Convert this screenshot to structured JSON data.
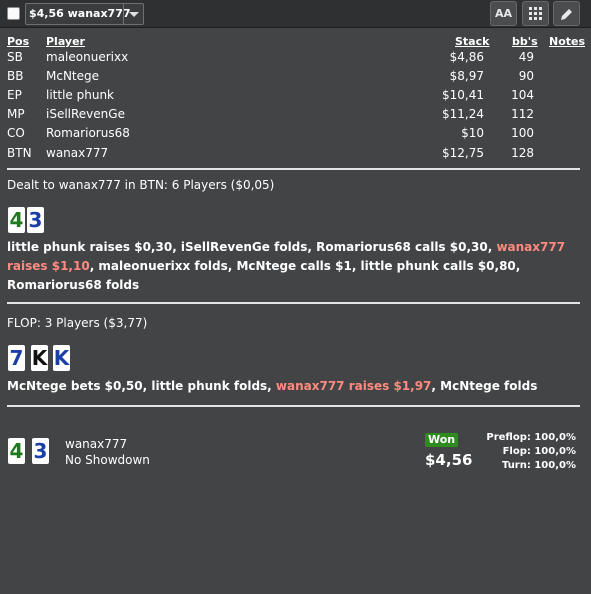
{
  "toolbar": {
    "dropdown_value": "$4,56 wanax777",
    "font_button_label": "AA"
  },
  "table": {
    "headers": {
      "pos": "Pos",
      "player": "Player",
      "stack": "Stack",
      "bbs": "bb's",
      "notes": "Notes"
    },
    "rows": [
      {
        "pos": "SB",
        "player": "maleonuerixx",
        "stack": "$4,86",
        "bbs": "49"
      },
      {
        "pos": "BB",
        "player": "McNtege",
        "stack": "$8,97",
        "bbs": "90"
      },
      {
        "pos": "EP",
        "player": "little phunk",
        "stack": "$10,41",
        "bbs": "104"
      },
      {
        "pos": "MP",
        "player": "iSellRevenGe",
        "stack": "$11,24",
        "bbs": "112"
      },
      {
        "pos": "CO",
        "player": "Romariorus68",
        "stack": "$10",
        "bbs": "100"
      },
      {
        "pos": "BTN",
        "player": "wanax777",
        "stack": "$12,75",
        "bbs": "128"
      }
    ]
  },
  "preflop": {
    "header": "Dealt to wanax777 in BTN: 6 Players ($0,05)",
    "hero_cards": [
      {
        "rank": "4",
        "suit_color": "green"
      },
      {
        "rank": "3",
        "suit_color": "blue"
      }
    ],
    "actions": {
      "part1": "little phunk raises $0,30, iSellRevenGe folds, Romariorus68 calls $0,30, ",
      "highlight": "wanax777 raises $1,10",
      "part2": ", maleonuerixx folds, McNtege calls $1, little phunk calls $0,80, Romariorus68 folds"
    }
  },
  "flop": {
    "header": "FLOP: 3 Players ($3,77)",
    "board_cards": [
      {
        "rank": "7",
        "suit_color": "blue"
      },
      {
        "rank": "K",
        "suit_color": "black"
      },
      {
        "rank": "K",
        "suit_color": "blue"
      }
    ],
    "actions": {
      "part1": "McNtege bets $0,50, little phunk folds, ",
      "highlight": "wanax777 raises $1,97",
      "part2": ", McNtege folds"
    }
  },
  "result": {
    "hero_cards": [
      {
        "rank": "4",
        "suit_color": "green"
      },
      {
        "rank": "3",
        "suit_color": "blue"
      }
    ],
    "player": "wanax777",
    "showdown": "No Showdown",
    "badge": "Won",
    "amount": "$4,56",
    "equity": [
      {
        "label": "Preflop: 100,0%"
      },
      {
        "label": "Flop: 100,0%"
      },
      {
        "label": "Turn: 100,0%"
      }
    ]
  },
  "colors": {
    "background": "#424446",
    "highlight": "#ff8a80",
    "won_badge": "#2e8b1e"
  }
}
